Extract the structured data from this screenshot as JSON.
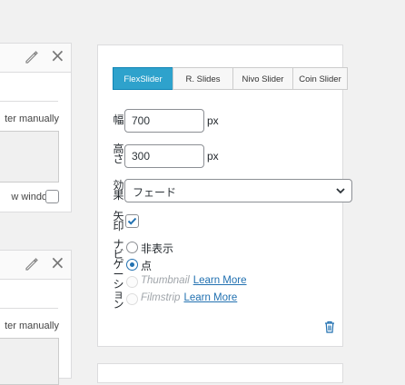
{
  "left_panels": [
    {
      "text_manual": "ter manually",
      "text_window": "w window"
    },
    {
      "text_manual": "ter manually"
    }
  ],
  "slider_panel": {
    "tabs": [
      {
        "label": "FlexSlider",
        "active": true
      },
      {
        "label": "R. Slides",
        "active": false
      },
      {
        "label": "Nivo Slider",
        "active": false
      },
      {
        "label": "Coin Slider",
        "active": false
      }
    ],
    "width": {
      "label": "幅",
      "value": "700",
      "unit": "px"
    },
    "height": {
      "label": "高さ",
      "value": "300",
      "unit": "px"
    },
    "effect": {
      "label": "効果",
      "value": "フェード"
    },
    "arrows": {
      "label": "矢印",
      "checked": true
    },
    "navigation": {
      "label": "ナビゲーション",
      "options": [
        {
          "label": "非表示",
          "selected": false,
          "disabled": false
        },
        {
          "label": "点",
          "selected": true,
          "disabled": false
        },
        {
          "label": "Thumbnail",
          "link": "Learn More",
          "selected": false,
          "disabled": true
        },
        {
          "label": "Filmstrip",
          "link": "Learn More",
          "selected": false,
          "disabled": true
        }
      ]
    }
  },
  "colors": {
    "accent": "#2ea2cc",
    "link": "#2271b1"
  }
}
